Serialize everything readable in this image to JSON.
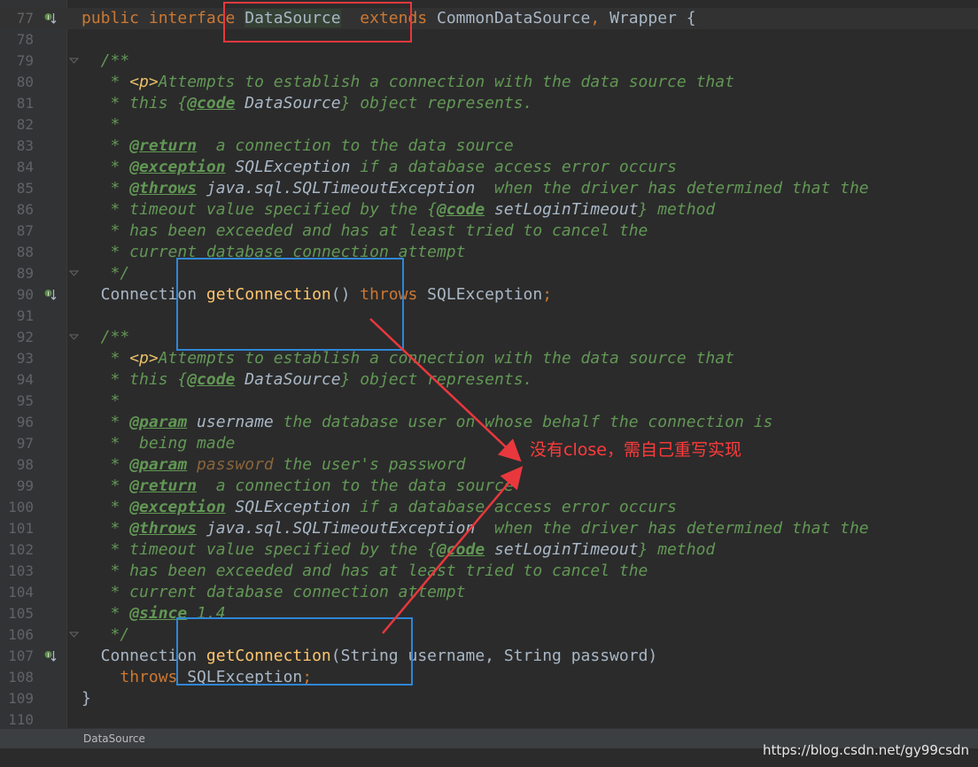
{
  "editor": {
    "lines": [
      {
        "n": "77",
        "marker": true,
        "current": true,
        "tokens": [
          {
            "t": "kw",
            "v": "public interface "
          },
          {
            "t": "cls hl",
            "v": "DataSource"
          },
          {
            "t": "plain",
            "v": "  "
          },
          {
            "t": "kw",
            "v": "extends "
          },
          {
            "t": "cls",
            "v": "CommonDataSource"
          },
          {
            "t": "kw",
            "v": ", "
          },
          {
            "t": "cls",
            "v": "Wrapper {"
          }
        ]
      },
      {
        "n": "78",
        "tokens": []
      },
      {
        "n": "79",
        "fold": true,
        "tokens": [
          {
            "t": "doc",
            "v": "  /**"
          }
        ]
      },
      {
        "n": "80",
        "tokens": [
          {
            "t": "doc",
            "v": "   * "
          },
          {
            "t": "htmltag",
            "v": "<p>"
          },
          {
            "t": "doc",
            "v": "Attempts to establish a connection with the data source that"
          }
        ]
      },
      {
        "n": "81",
        "tokens": [
          {
            "t": "doc",
            "v": "   * this {"
          },
          {
            "t": "doctag",
            "v": "@code"
          },
          {
            "t": "docplain",
            "v": " DataSource"
          },
          {
            "t": "doc",
            "v": "} object represents."
          }
        ]
      },
      {
        "n": "82",
        "tokens": [
          {
            "t": "doc",
            "v": "   *"
          }
        ]
      },
      {
        "n": "83",
        "tokens": [
          {
            "t": "doc",
            "v": "   * "
          },
          {
            "t": "doctag",
            "v": "@return"
          },
          {
            "t": "doc",
            "v": "  a connection to the data source"
          }
        ]
      },
      {
        "n": "84",
        "tokens": [
          {
            "t": "doc",
            "v": "   * "
          },
          {
            "t": "doctag",
            "v": "@exception"
          },
          {
            "t": "docplain",
            "v": " SQLException"
          },
          {
            "t": "doc",
            "v": " if a database access error occurs"
          }
        ]
      },
      {
        "n": "85",
        "tokens": [
          {
            "t": "doc",
            "v": "   * "
          },
          {
            "t": "doctag",
            "v": "@throws"
          },
          {
            "t": "docplain",
            "v": " java.sql.SQLTimeoutException"
          },
          {
            "t": "doc",
            "v": "  when the driver has determined that the"
          }
        ]
      },
      {
        "n": "86",
        "tokens": [
          {
            "t": "doc",
            "v": "   * timeout value specified by the {"
          },
          {
            "t": "doctag",
            "v": "@code"
          },
          {
            "t": "docplain",
            "v": " setLoginTimeout"
          },
          {
            "t": "doc",
            "v": "} method"
          }
        ]
      },
      {
        "n": "87",
        "tokens": [
          {
            "t": "doc",
            "v": "   * has been exceeded and has at least tried to cancel the"
          }
        ]
      },
      {
        "n": "88",
        "tokens": [
          {
            "t": "doc",
            "v": "   * current database connection attempt"
          }
        ]
      },
      {
        "n": "89",
        "fold": true,
        "tokens": [
          {
            "t": "doc",
            "v": "   */"
          }
        ]
      },
      {
        "n": "90",
        "marker": true,
        "tokens": [
          {
            "t": "plain",
            "v": "  Connection "
          },
          {
            "t": "fn",
            "v": "getConnection"
          },
          {
            "t": "plain",
            "v": "() "
          },
          {
            "t": "kw",
            "v": "throws "
          },
          {
            "t": "plain",
            "v": "SQLException"
          },
          {
            "t": "kw",
            "v": ";"
          }
        ]
      },
      {
        "n": "91",
        "tokens": []
      },
      {
        "n": "92",
        "fold": true,
        "tokens": [
          {
            "t": "doc",
            "v": "  /**"
          }
        ]
      },
      {
        "n": "93",
        "tokens": [
          {
            "t": "doc",
            "v": "   * "
          },
          {
            "t": "htmltag",
            "v": "<p>"
          },
          {
            "t": "doc",
            "v": "Attempts to establish a connection with the data source that"
          }
        ]
      },
      {
        "n": "94",
        "tokens": [
          {
            "t": "doc",
            "v": "   * this {"
          },
          {
            "t": "doctag",
            "v": "@code"
          },
          {
            "t": "docplain",
            "v": " DataSource"
          },
          {
            "t": "doc",
            "v": "} object represents."
          }
        ]
      },
      {
        "n": "95",
        "tokens": [
          {
            "t": "doc",
            "v": "   *"
          }
        ]
      },
      {
        "n": "96",
        "tokens": [
          {
            "t": "doc",
            "v": "   * "
          },
          {
            "t": "doctag",
            "v": "@param"
          },
          {
            "t": "docplain",
            "v": " username"
          },
          {
            "t": "doc",
            "v": " the database user on whose behalf the connection is"
          }
        ]
      },
      {
        "n": "97",
        "tokens": [
          {
            "t": "doc",
            "v": "   *  being made"
          }
        ]
      },
      {
        "n": "98",
        "tokens": [
          {
            "t": "doc",
            "v": "   * "
          },
          {
            "t": "doctag",
            "v": "@param"
          },
          {
            "t": "docval",
            "v": " password"
          },
          {
            "t": "doc",
            "v": " the user's password"
          }
        ]
      },
      {
        "n": "99",
        "tokens": [
          {
            "t": "doc",
            "v": "   * "
          },
          {
            "t": "doctag",
            "v": "@return"
          },
          {
            "t": "doc",
            "v": "  a connection to the data source"
          }
        ]
      },
      {
        "n": "100",
        "tokens": [
          {
            "t": "doc",
            "v": "   * "
          },
          {
            "t": "doctag",
            "v": "@exception"
          },
          {
            "t": "docplain",
            "v": " SQLException"
          },
          {
            "t": "doc",
            "v": " if a database access error occurs"
          }
        ]
      },
      {
        "n": "101",
        "tokens": [
          {
            "t": "doc",
            "v": "   * "
          },
          {
            "t": "doctag",
            "v": "@throws"
          },
          {
            "t": "docplain",
            "v": " java.sql.SQLTimeoutException"
          },
          {
            "t": "doc",
            "v": "  when the driver has determined that the"
          }
        ]
      },
      {
        "n": "102",
        "tokens": [
          {
            "t": "doc",
            "v": "   * timeout value specified by the {"
          },
          {
            "t": "doctag",
            "v": "@code"
          },
          {
            "t": "docplain",
            "v": " setLoginTimeout"
          },
          {
            "t": "doc",
            "v": "} method"
          }
        ]
      },
      {
        "n": "103",
        "tokens": [
          {
            "t": "doc",
            "v": "   * has been exceeded and has at least tried to cancel the"
          }
        ]
      },
      {
        "n": "104",
        "tokens": [
          {
            "t": "doc",
            "v": "   * current database connection attempt"
          }
        ]
      },
      {
        "n": "105",
        "tokens": [
          {
            "t": "doc",
            "v": "   * "
          },
          {
            "t": "doctag",
            "v": "@since"
          },
          {
            "t": "doc",
            "v": " 1.4"
          }
        ]
      },
      {
        "n": "106",
        "fold": true,
        "tokens": [
          {
            "t": "doc",
            "v": "   */"
          }
        ]
      },
      {
        "n": "107",
        "marker": true,
        "tokens": [
          {
            "t": "plain",
            "v": "  Connection "
          },
          {
            "t": "fn",
            "v": "getConnection"
          },
          {
            "t": "plain",
            "v": "(String username, String password)"
          }
        ]
      },
      {
        "n": "108",
        "tokens": [
          {
            "t": "plain",
            "v": "    "
          },
          {
            "t": "kw",
            "v": "throws "
          },
          {
            "t": "plain",
            "v": "SQLException"
          },
          {
            "t": "kw",
            "v": ";"
          }
        ]
      },
      {
        "n": "109",
        "tokens": [
          {
            "t": "plain",
            "v": "}"
          }
        ]
      },
      {
        "n": "110",
        "tokens": []
      }
    ]
  },
  "statusbar": {
    "breadcrumb": "DataSource"
  },
  "watermark": "https://blog.csdn.net/gy99csdn",
  "annotation": {
    "text": "没有close，需自己重写实现",
    "color": "#ff3b3b"
  },
  "colors": {
    "box_red": "#e8383d",
    "box_blue": "#2f86d6",
    "arrow": "#e8383d"
  },
  "icons": {
    "gutter_marker": "implemented-method-icon",
    "fold": "fold-marker-icon"
  }
}
